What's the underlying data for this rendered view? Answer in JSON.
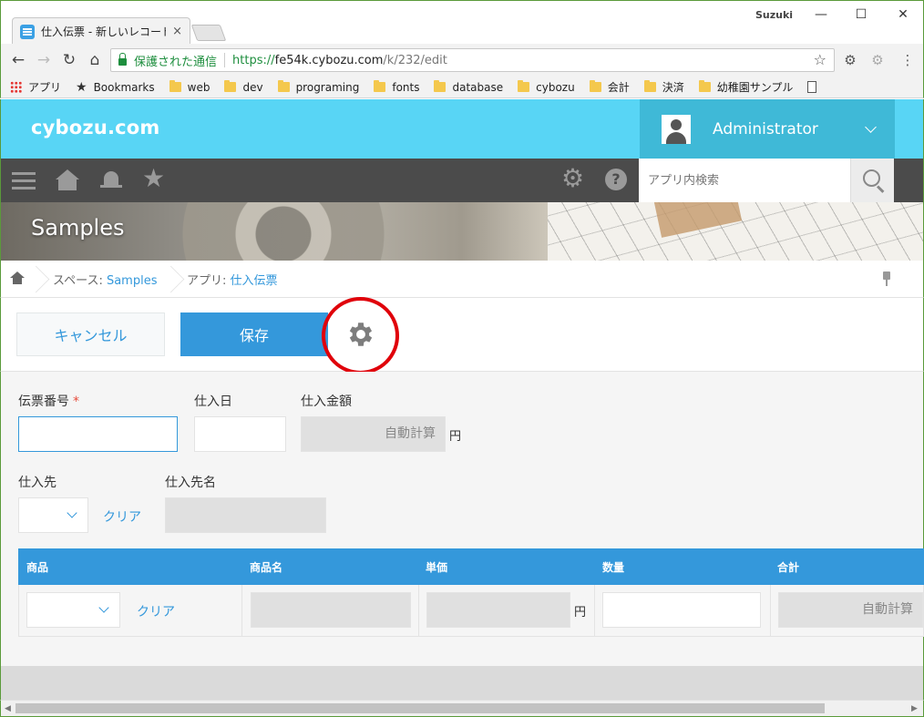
{
  "browser": {
    "tab_title": "仕入伝票 - 新しいレコード",
    "tab_close": "×",
    "profile_name": "Suzuki",
    "window": {
      "minimize": "—",
      "maximize": "☐",
      "close": "✕"
    },
    "nav": {
      "back": "←",
      "forward": "→",
      "reload": "↻",
      "home": "⌂"
    },
    "secure_label": "保護された通信",
    "url_scheme": "https://",
    "url_host": "fe54k.cybozu.com",
    "url_path": "/k/232/edit",
    "menu_glyph": "⋮",
    "bookmark_star": "☆",
    "bookmarks": [
      {
        "label": "アプリ",
        "icon": "apps-icon"
      },
      {
        "label": "Bookmarks",
        "icon": "star-icon"
      },
      {
        "label": "web",
        "icon": "folder-icon"
      },
      {
        "label": "dev",
        "icon": "folder-icon"
      },
      {
        "label": "programing",
        "icon": "folder-icon"
      },
      {
        "label": "fonts",
        "icon": "folder-icon"
      },
      {
        "label": "database",
        "icon": "folder-icon"
      },
      {
        "label": "cybozu",
        "icon": "folder-icon"
      },
      {
        "label": "会計",
        "icon": "folder-icon"
      },
      {
        "label": "決済",
        "icon": "folder-icon"
      },
      {
        "label": "幼稚園サンプル",
        "icon": "folder-icon"
      },
      {
        "label": "",
        "icon": "document-icon"
      }
    ]
  },
  "header": {
    "brand": "cybozu.com",
    "user_name": "Administrator",
    "accent_color": "#58d5f5",
    "user_box_color": "#3fb9d7"
  },
  "toolbar": {
    "help_glyph": "?",
    "star_glyph": "★",
    "gear_glyph": "⚙",
    "search_placeholder": "アプリ内検索"
  },
  "space": {
    "title": "Samples"
  },
  "breadcrumb": {
    "space_prefix": "スペース:",
    "space_name": "Samples",
    "app_prefix": "アプリ:",
    "app_name": "仕入伝票"
  },
  "actions": {
    "cancel_label": "キャンセル",
    "save_label": "保存",
    "primary_color": "#3498db",
    "highlight_color": "#e0000a"
  },
  "form": {
    "voucher_no": {
      "label": "伝票番号",
      "required_mark": "*",
      "value": ""
    },
    "purchase_date": {
      "label": "仕入日",
      "value": ""
    },
    "purchase_amount": {
      "label": "仕入金額",
      "value": "自動計算",
      "unit": "円"
    },
    "supplier": {
      "label": "仕入先",
      "clear": "クリア"
    },
    "supplier_name": {
      "label": "仕入先名",
      "value": ""
    },
    "table": {
      "headers": [
        "商品",
        "商品名",
        "単価",
        "数量",
        "合計"
      ],
      "row": {
        "clear": "クリア",
        "unit_price_unit": "円",
        "total": "自動計算"
      }
    }
  }
}
